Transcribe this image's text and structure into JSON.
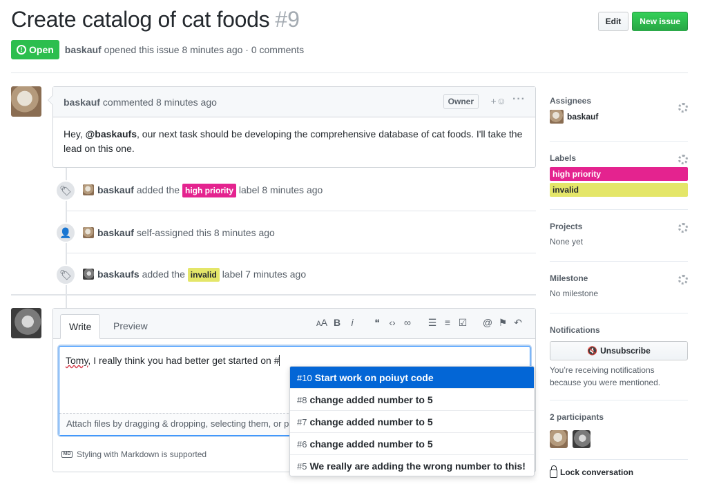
{
  "issue": {
    "title": "Create catalog of cat foods",
    "number": "#9",
    "state": "Open",
    "author": "baskauf",
    "meta": "opened this issue 8 minutes ago · 0 comments",
    "edit_label": "Edit",
    "new_issue_label": "New issue"
  },
  "comment": {
    "author": "baskauf",
    "time": "commented 8 minutes ago",
    "role": "Owner",
    "body_pre": "Hey, ",
    "mention": "@baskaufs",
    "body_post": ", our next task should be developing the comprehensive database of cat foods. I'll take the lead on this one."
  },
  "events": [
    {
      "actor": "baskauf",
      "pre": "added the",
      "label": "high priority",
      "post": "label 8 minutes ago"
    },
    {
      "actor": "baskauf",
      "text": "self-assigned this 8 minutes ago"
    },
    {
      "actor": "baskaufs",
      "pre": "added the",
      "label": "invalid",
      "post": "label 7 minutes ago"
    }
  ],
  "editor": {
    "tab_write": "Write",
    "tab_preview": "Preview",
    "text_squiggle": "Tomy",
    "text_rest": ", I really think you had better get started on #",
    "attach_hint": "Attach files by dragging & dropping, selecting them, or pasting from the clipboard.",
    "markdown_note": "Styling with Markdown is supported",
    "markdown_badge": "MD"
  },
  "suggestions": [
    {
      "num": "#10",
      "title": "Start work on poiuyt code",
      "active": true
    },
    {
      "num": "#8",
      "title": "change added number to 5"
    },
    {
      "num": "#7",
      "title": "change added number to 5"
    },
    {
      "num": "#6",
      "title": "change added number to 5"
    },
    {
      "num": "#5",
      "title": "We really are adding the wrong number to this!"
    }
  ],
  "sidebar": {
    "assignees_title": "Assignees",
    "assignee": "baskauf",
    "labels_title": "Labels",
    "labels": [
      {
        "name": "high priority",
        "color": "#e4238f",
        "text_color": "#ffffff"
      },
      {
        "name": "invalid",
        "color": "#e4e669",
        "text_color": "#24292e"
      }
    ],
    "projects_title": "Projects",
    "projects_value": "None yet",
    "milestone_title": "Milestone",
    "milestone_value": "No milestone",
    "notifications_title": "Notifications",
    "unsubscribe_label": "Unsubscribe",
    "notifications_text": "You’re receiving notifications because you were mentioned.",
    "participants_title": "2 participants",
    "lock_label": "Lock conversation"
  },
  "colors": {
    "open_green": "#2cbe4e",
    "link_blue": "#0366d6",
    "high_priority": "#e4238f",
    "invalid": "#e4e669"
  }
}
